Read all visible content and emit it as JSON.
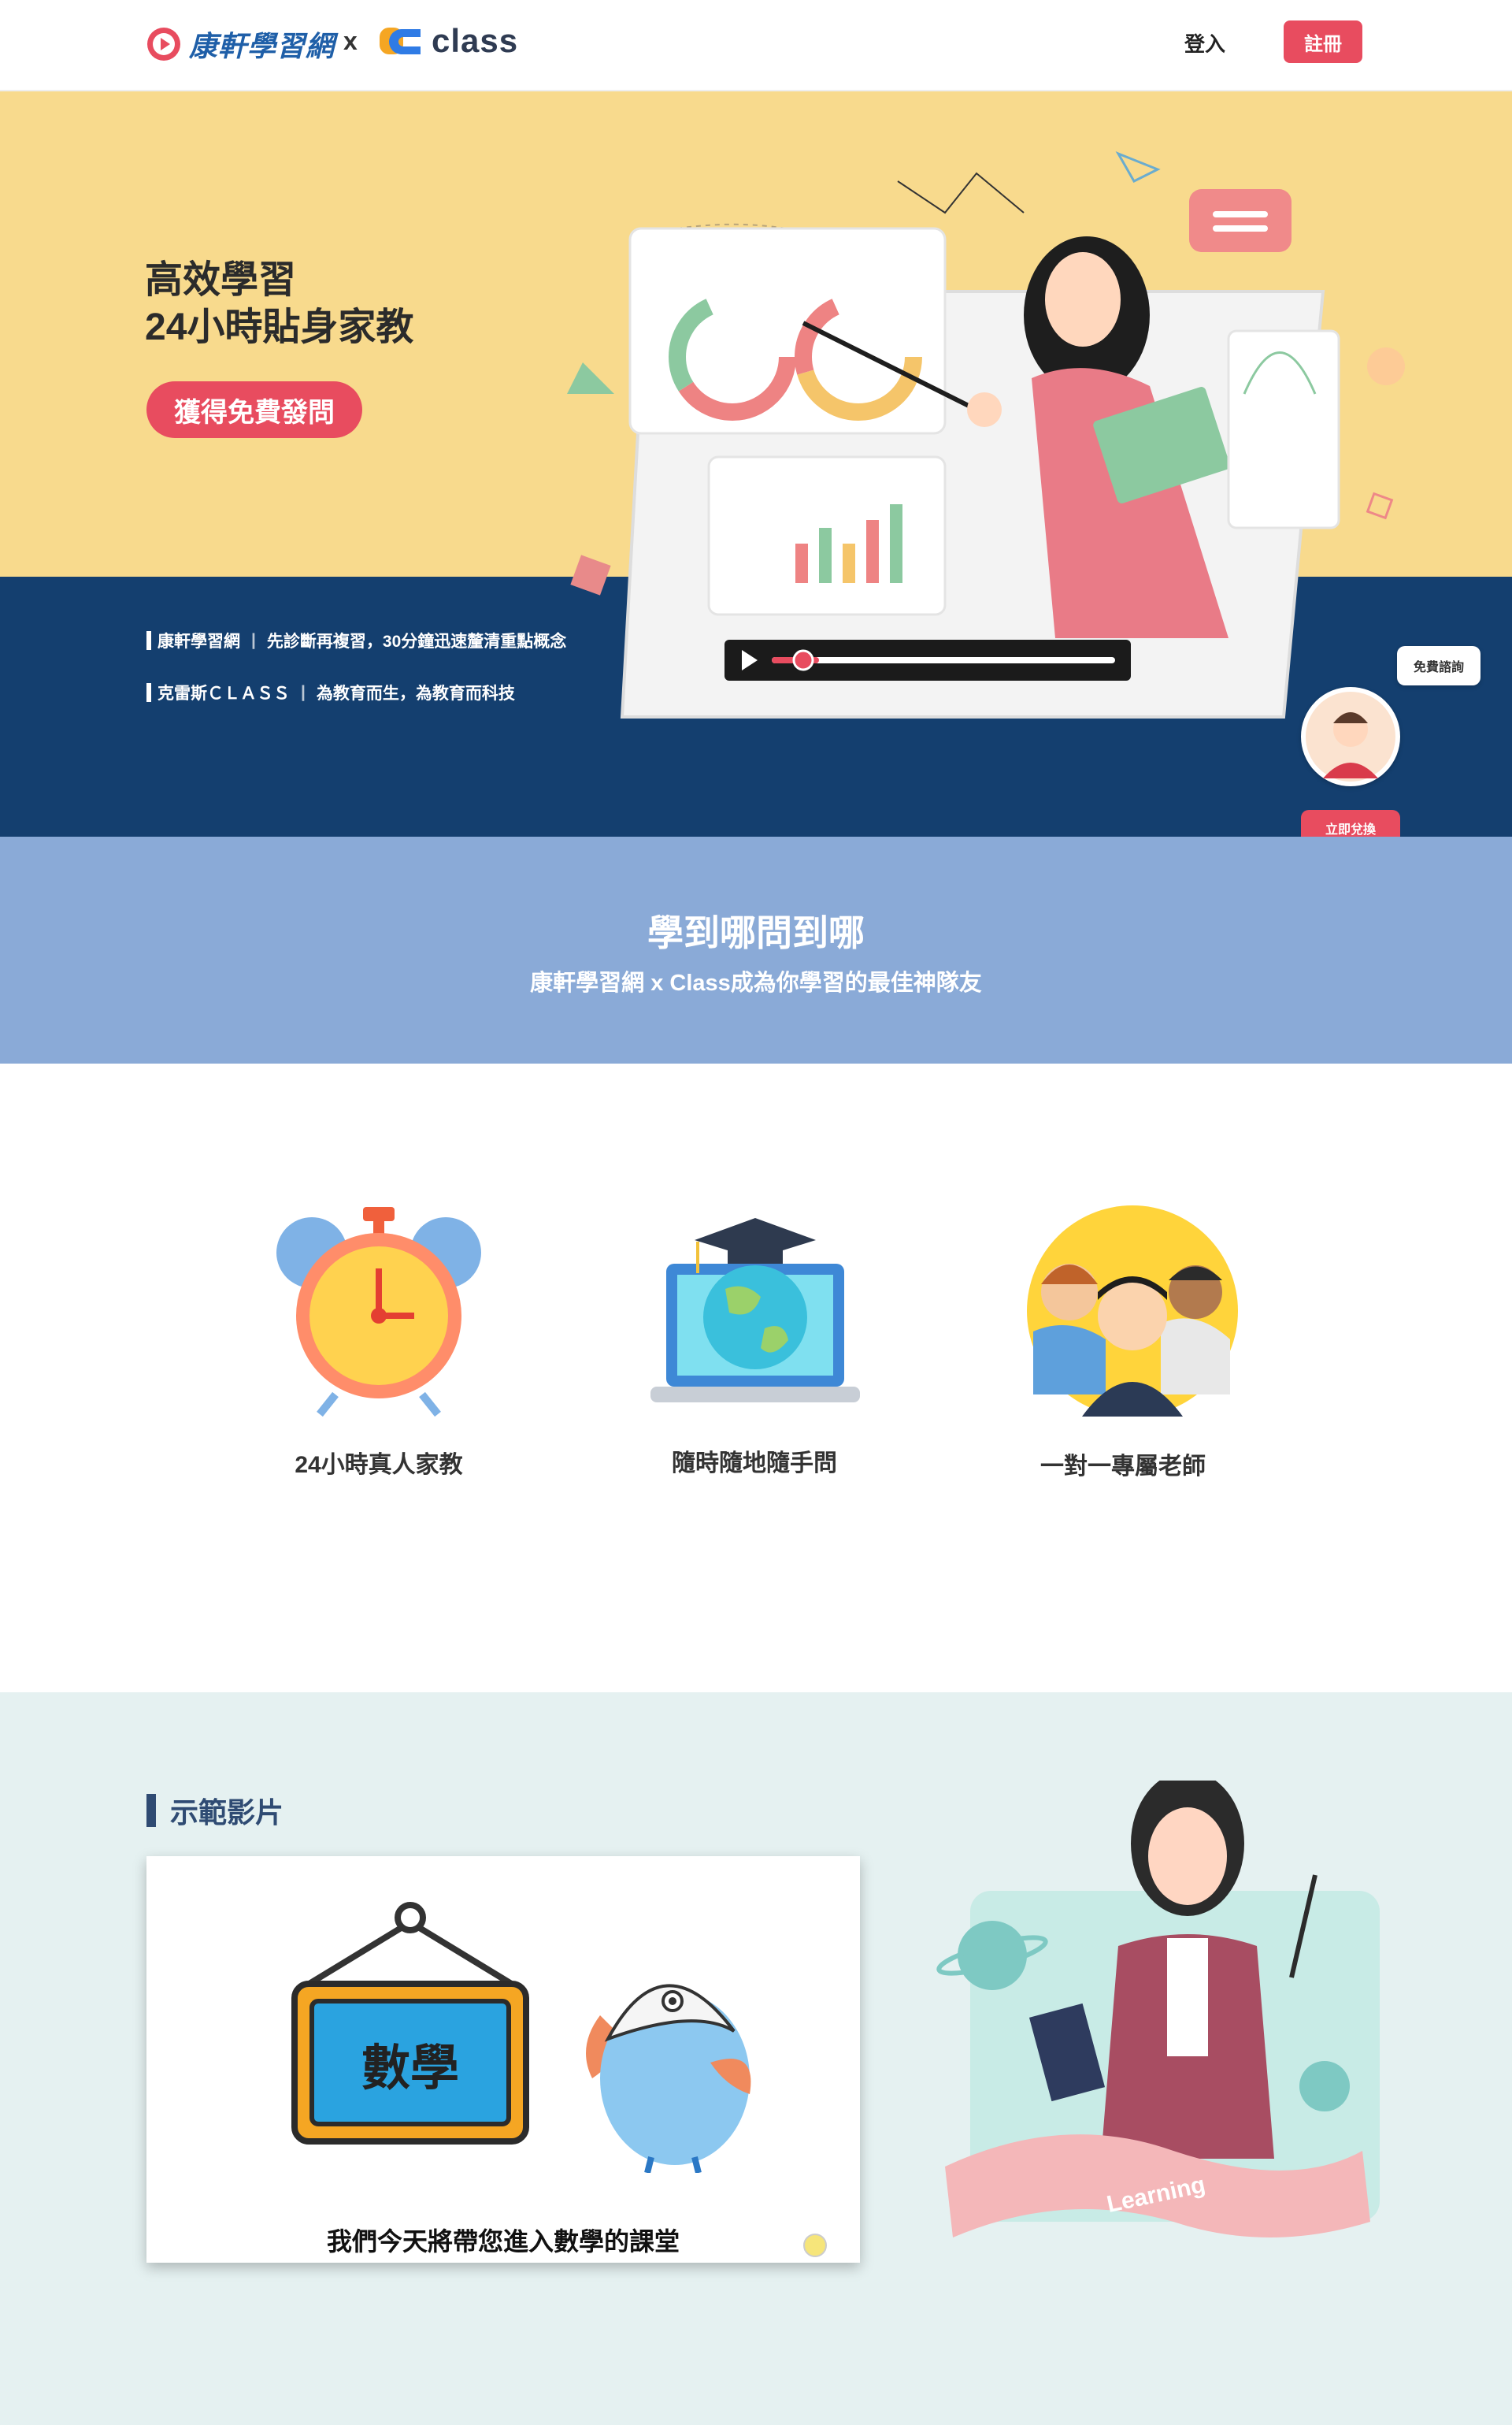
{
  "header": {
    "kh_logo_text": "康軒學習網",
    "x_text": "x",
    "class_logo_text": "class",
    "login_label": "登入",
    "register_label": "註冊"
  },
  "hero": {
    "title_line1": "高效學習",
    "title_line2": "24小時貼身家教",
    "cta_label": "獲得免費發問",
    "tag1_name": "康軒學習網",
    "tag1_desc": "先診斷再複習，30分鐘迅速釐清重點概念",
    "tag2_name": "克雷斯ＣＬＡＳＳ",
    "tag2_desc": "為教育而生，為教育而科技"
  },
  "floating": {
    "consult_label": "免費諮詢",
    "redeem_label": "立即兌換"
  },
  "band": {
    "title": "學到哪問到哪",
    "subtitle": "康軒學習網 x Class成為你學習的最佳神隊友"
  },
  "features": [
    {
      "label": "24小時真人家教",
      "icon": "alarm-clock-icon"
    },
    {
      "label": "隨時隨地隨手問",
      "icon": "laptop-globe-icon"
    },
    {
      "label": "一對一專屬老師",
      "icon": "teachers-group-icon"
    }
  ],
  "demo": {
    "title": "示範影片",
    "video_sign_text": "數學",
    "video_caption": "我們今天將帶您進入數學的課堂",
    "ribbon_text": "Learning"
  },
  "colors": {
    "accent_red": "#e84c5f",
    "hero_yellow": "#f8da8d",
    "hero_navy": "#143f6f",
    "band_blue": "#8aaad7",
    "demo_bg": "#e5f1f1"
  }
}
